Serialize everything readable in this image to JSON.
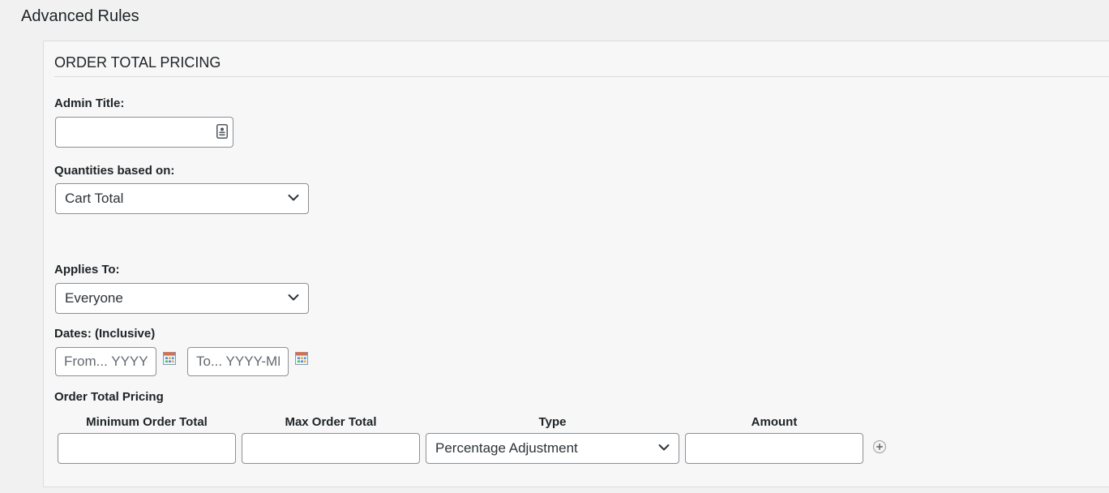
{
  "page": {
    "title": "Advanced Rules"
  },
  "panel": {
    "title": "ORDER TOTAL PRICING"
  },
  "admin_title": {
    "label": "Admin Title:",
    "value": ""
  },
  "quantities": {
    "label": "Quantities based on:",
    "selected": "Cart Total"
  },
  "applies_to": {
    "label": "Applies To:",
    "selected": "Everyone"
  },
  "dates": {
    "label": "Dates: (Inclusive)",
    "from_placeholder": "From... YYYY-MM-DD",
    "to_placeholder": "To... YYYY-MM-DD"
  },
  "pricing": {
    "label": "Order Total Pricing",
    "columns": [
      "Minimum Order Total",
      "Max Order Total",
      "Type",
      "Amount"
    ],
    "row": {
      "min": "",
      "max": "",
      "type": "Percentage Adjustment",
      "amount": ""
    }
  },
  "icons": {
    "admin_title_field": "contact-card-icon",
    "from_date": "calendar-icon",
    "to_date": "calendar-icon",
    "add_row": "add-circle-icon",
    "select_arrow": "chevron-down-icon"
  },
  "colors": {
    "page_bg": "#f1f1f1",
    "panel_bg": "#f7f7f7",
    "border": "#8c8f94",
    "text": "#1d2327"
  }
}
